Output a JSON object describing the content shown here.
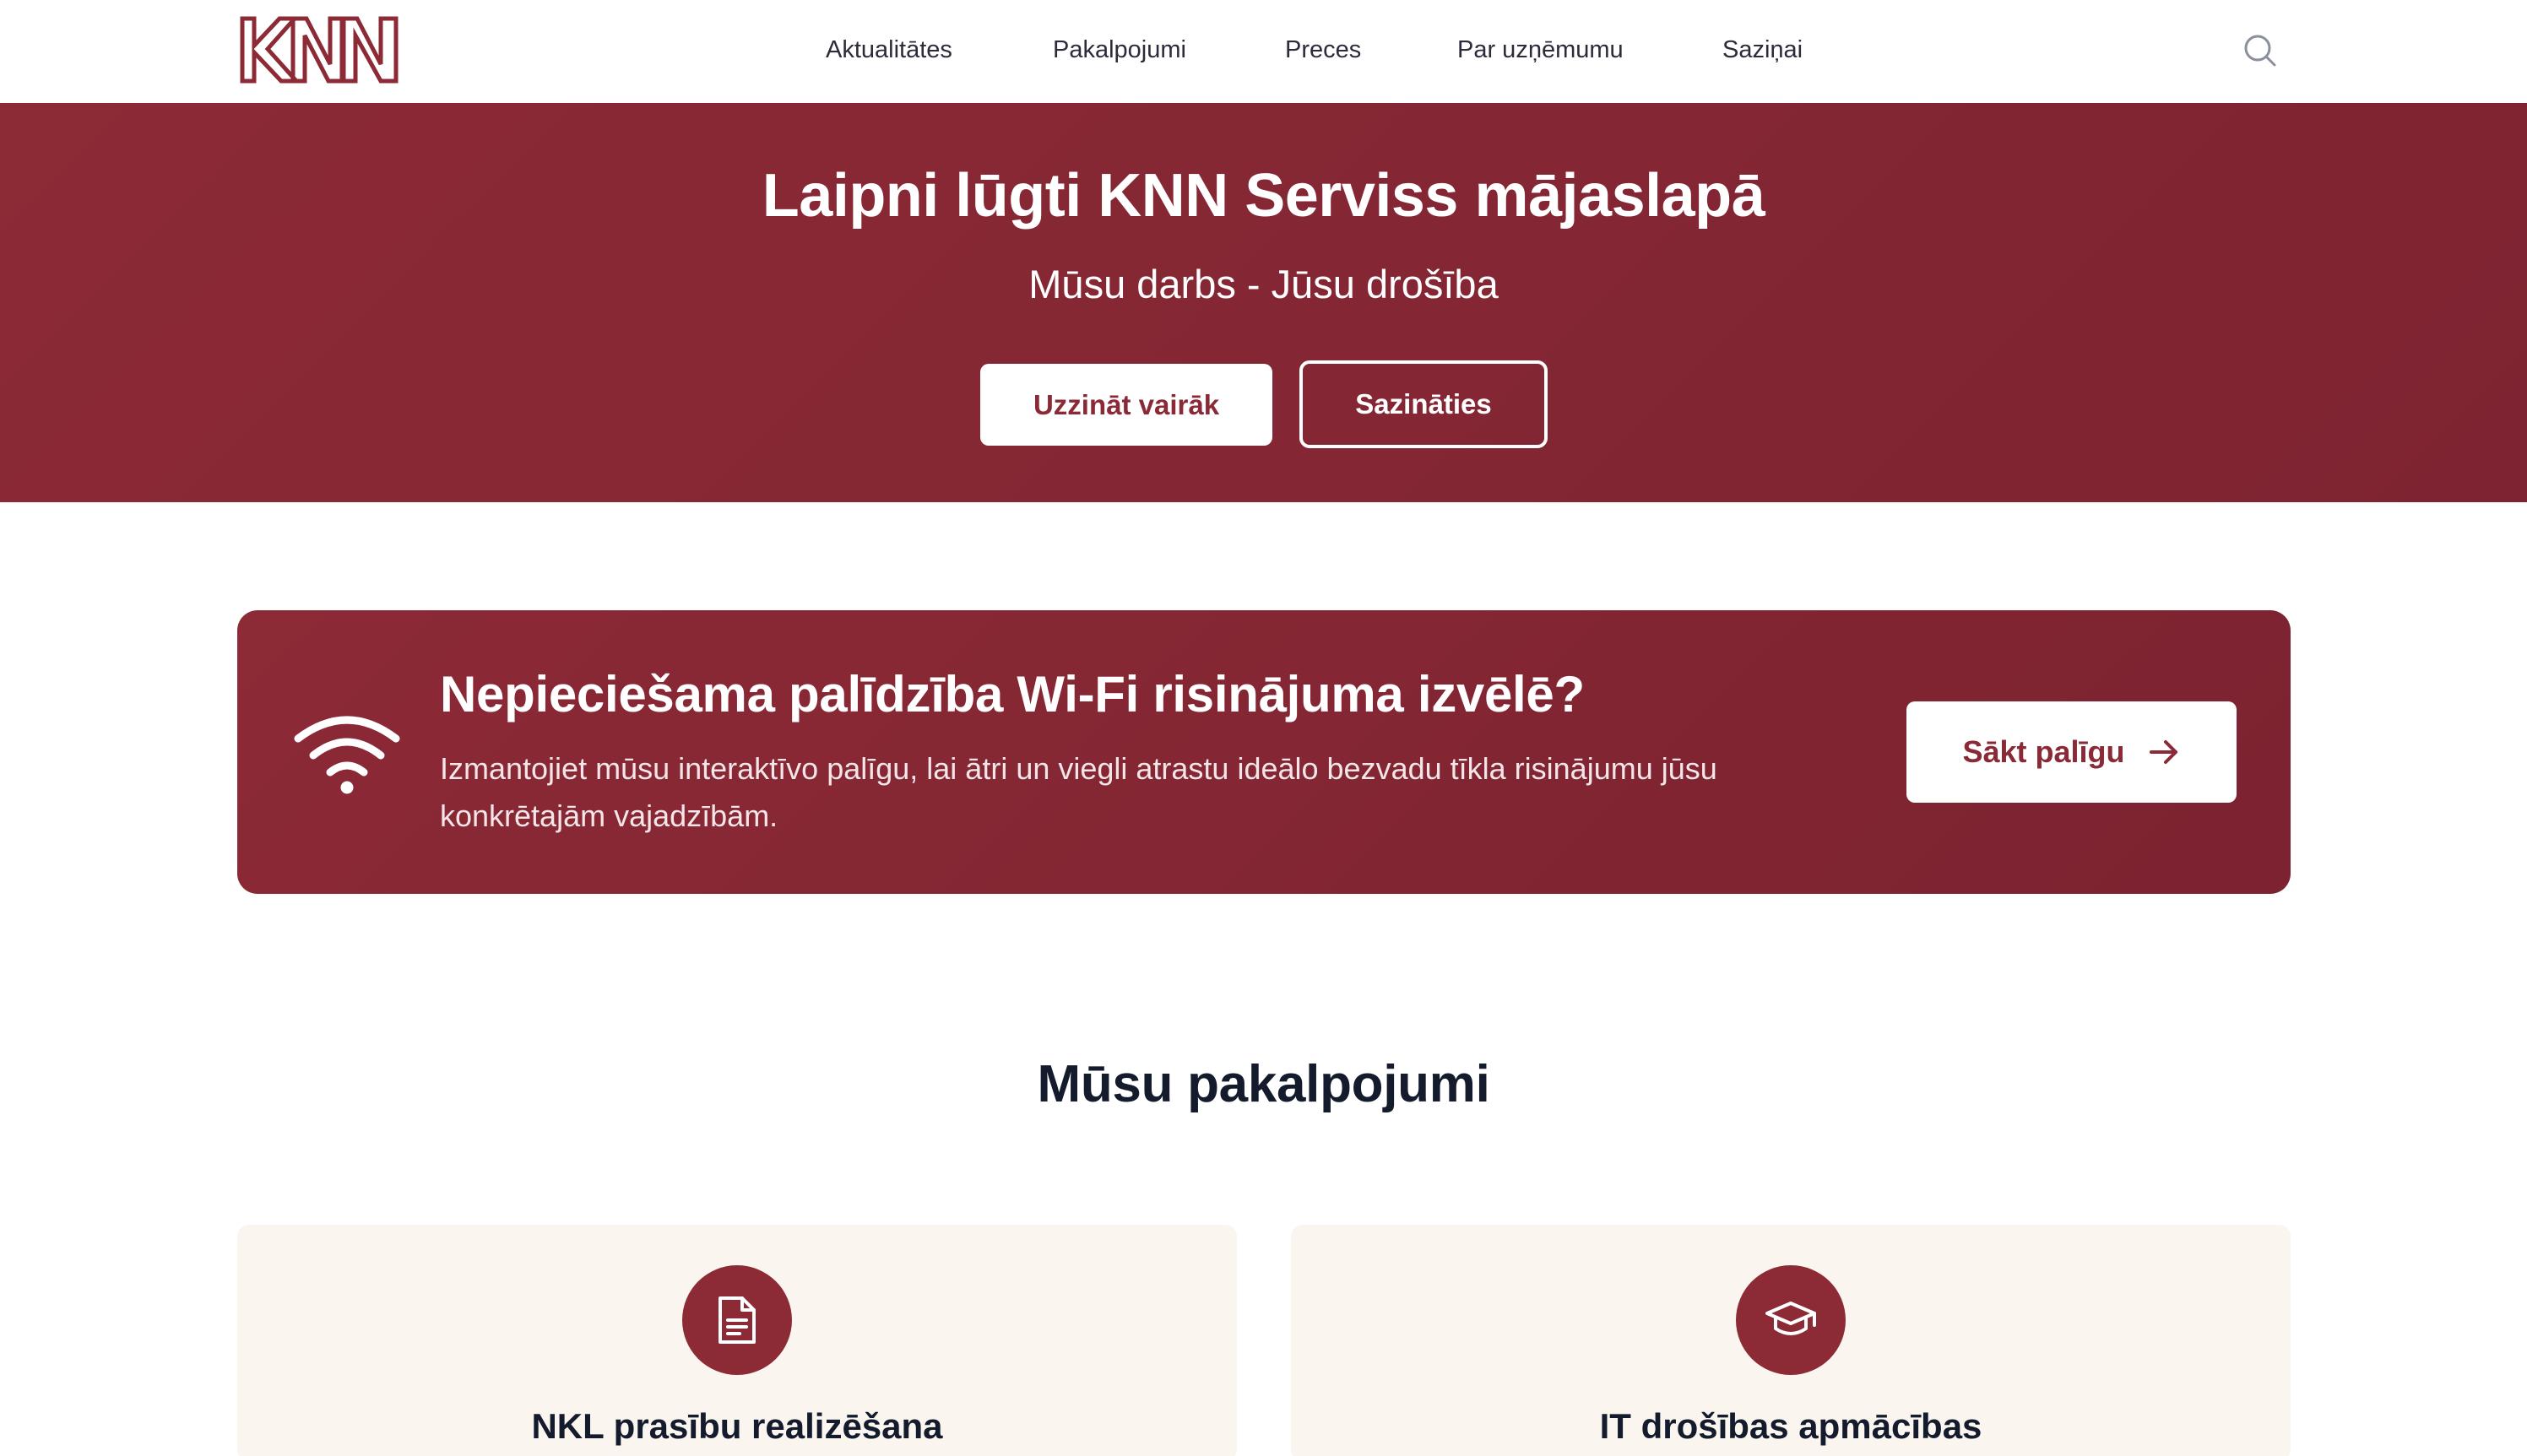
{
  "header": {
    "logo_text": "KNN",
    "nav": [
      {
        "label": "Aktualitātes"
      },
      {
        "label": "Pakalpojumi"
      },
      {
        "label": "Preces"
      },
      {
        "label": "Par uzņēmumu"
      },
      {
        "label": "Saziņai"
      }
    ],
    "search_icon": "search-icon"
  },
  "hero": {
    "title": "Laipni lūgti KNN Serviss mājaslapā",
    "subtitle": "Mūsu darbs - Jūsu drošība",
    "primary_button": "Uzzināt vairāk",
    "secondary_button": "Sazināties"
  },
  "banner": {
    "icon": "wifi-icon",
    "title": "Nepieciešama palīdzība Wi-Fi risinājuma izvēlē?",
    "text": "Izmantojiet mūsu interaktīvo palīgu, lai ātri un viegli atrastu ideālo bezvadu tīkla risinājumu jūsu konkrētajām vajadzībām.",
    "button": "Sākt palīgu",
    "button_icon": "arrow-right-icon"
  },
  "services": {
    "title": "Mūsu pakalpojumi",
    "cards": [
      {
        "icon": "document-icon",
        "title": "NKL prasību realizēšana"
      },
      {
        "icon": "graduation-cap-icon",
        "title": "IT drošības apmācības"
      }
    ]
  },
  "colors": {
    "brand": "#8c2a36",
    "card_bg": "#faf6ef",
    "heading": "#141b2d"
  }
}
